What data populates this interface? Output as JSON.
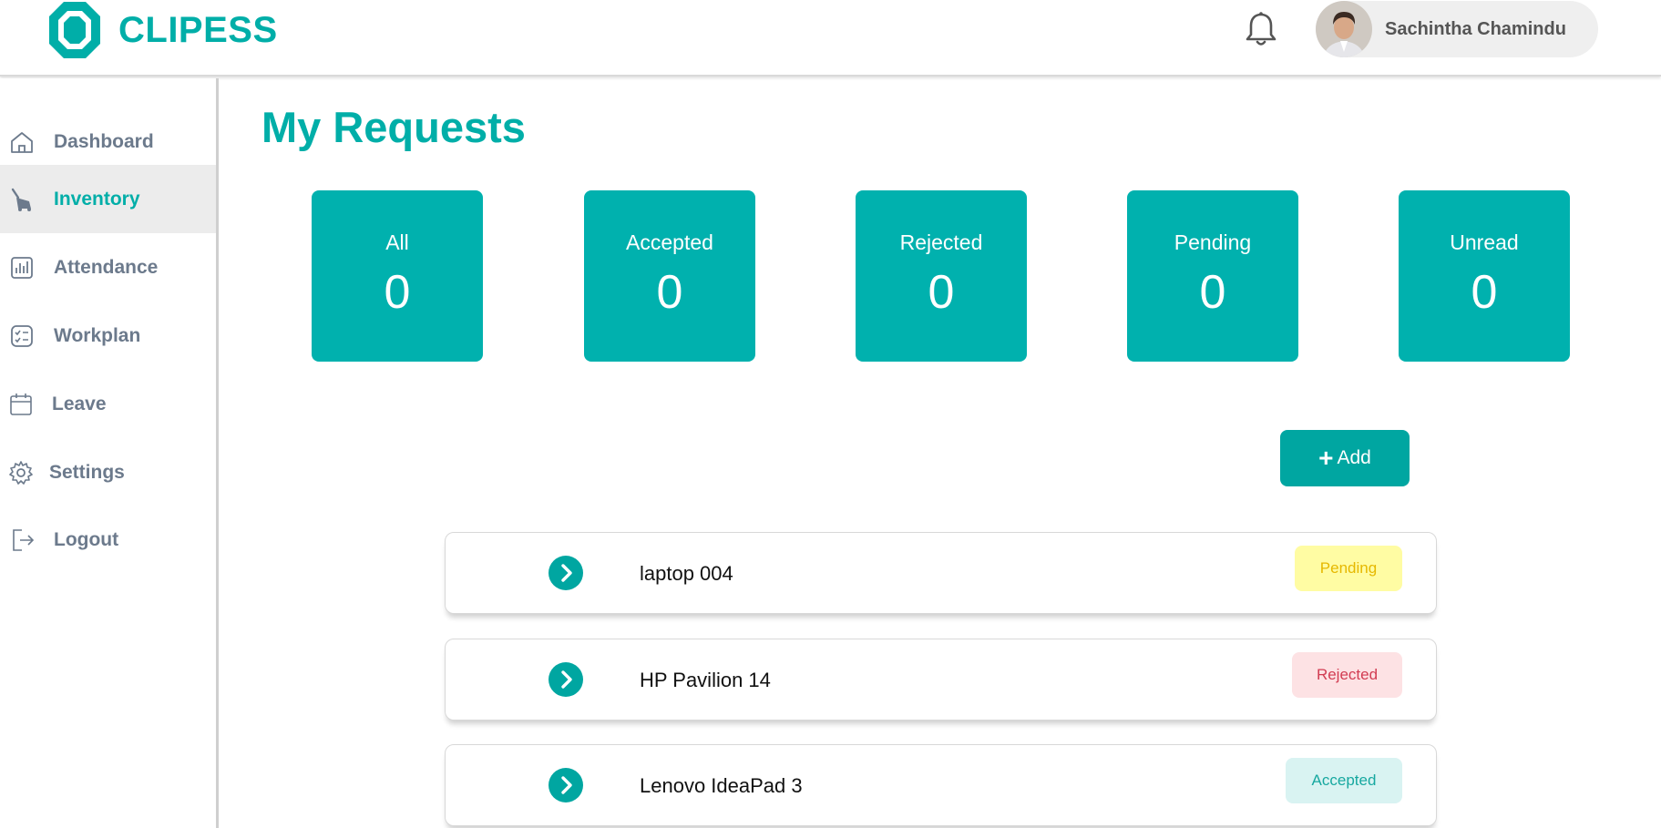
{
  "app": {
    "logo_text": "CLIPESS",
    "brand_color": "#00aea8"
  },
  "header": {
    "notification_icon": "bell-icon",
    "user": {
      "name": "Sachintha Chamindu",
      "avatar_icon": "avatar"
    }
  },
  "sidebar": {
    "items": [
      {
        "label": "Dashboard",
        "icon": "home-icon",
        "active": false
      },
      {
        "label": "Inventory",
        "icon": "vacuum-cleaner-icon",
        "active": true
      },
      {
        "label": "Attendance",
        "icon": "bar-chart-icon",
        "active": false
      },
      {
        "label": "Workplan",
        "icon": "checklist-icon",
        "active": false
      },
      {
        "label": "Leave",
        "icon": "calendar-icon",
        "active": false
      },
      {
        "label": "Settings",
        "icon": "gear-icon",
        "active": false
      },
      {
        "label": "Logout",
        "icon": "logout-icon",
        "active": false
      }
    ]
  },
  "main": {
    "title": "My Requests",
    "stats": [
      {
        "label": "All",
        "value": "0"
      },
      {
        "label": "Accepted",
        "value": "0"
      },
      {
        "label": "Rejected",
        "value": "0"
      },
      {
        "label": "Pending",
        "value": "0"
      },
      {
        "label": "Unread",
        "value": "0"
      }
    ],
    "add_button": {
      "plus": "+",
      "label": "Add"
    },
    "requests": [
      {
        "name": "laptop 004",
        "status": "Pending",
        "status_color": "#e6b800"
      },
      {
        "name": "HP Pavilion 14",
        "status": "Rejected",
        "status_color": "#d23c52"
      },
      {
        "name": "Lenovo IdeaPad 3",
        "status": "Accepted",
        "status_color": "#17a8a0"
      }
    ]
  }
}
